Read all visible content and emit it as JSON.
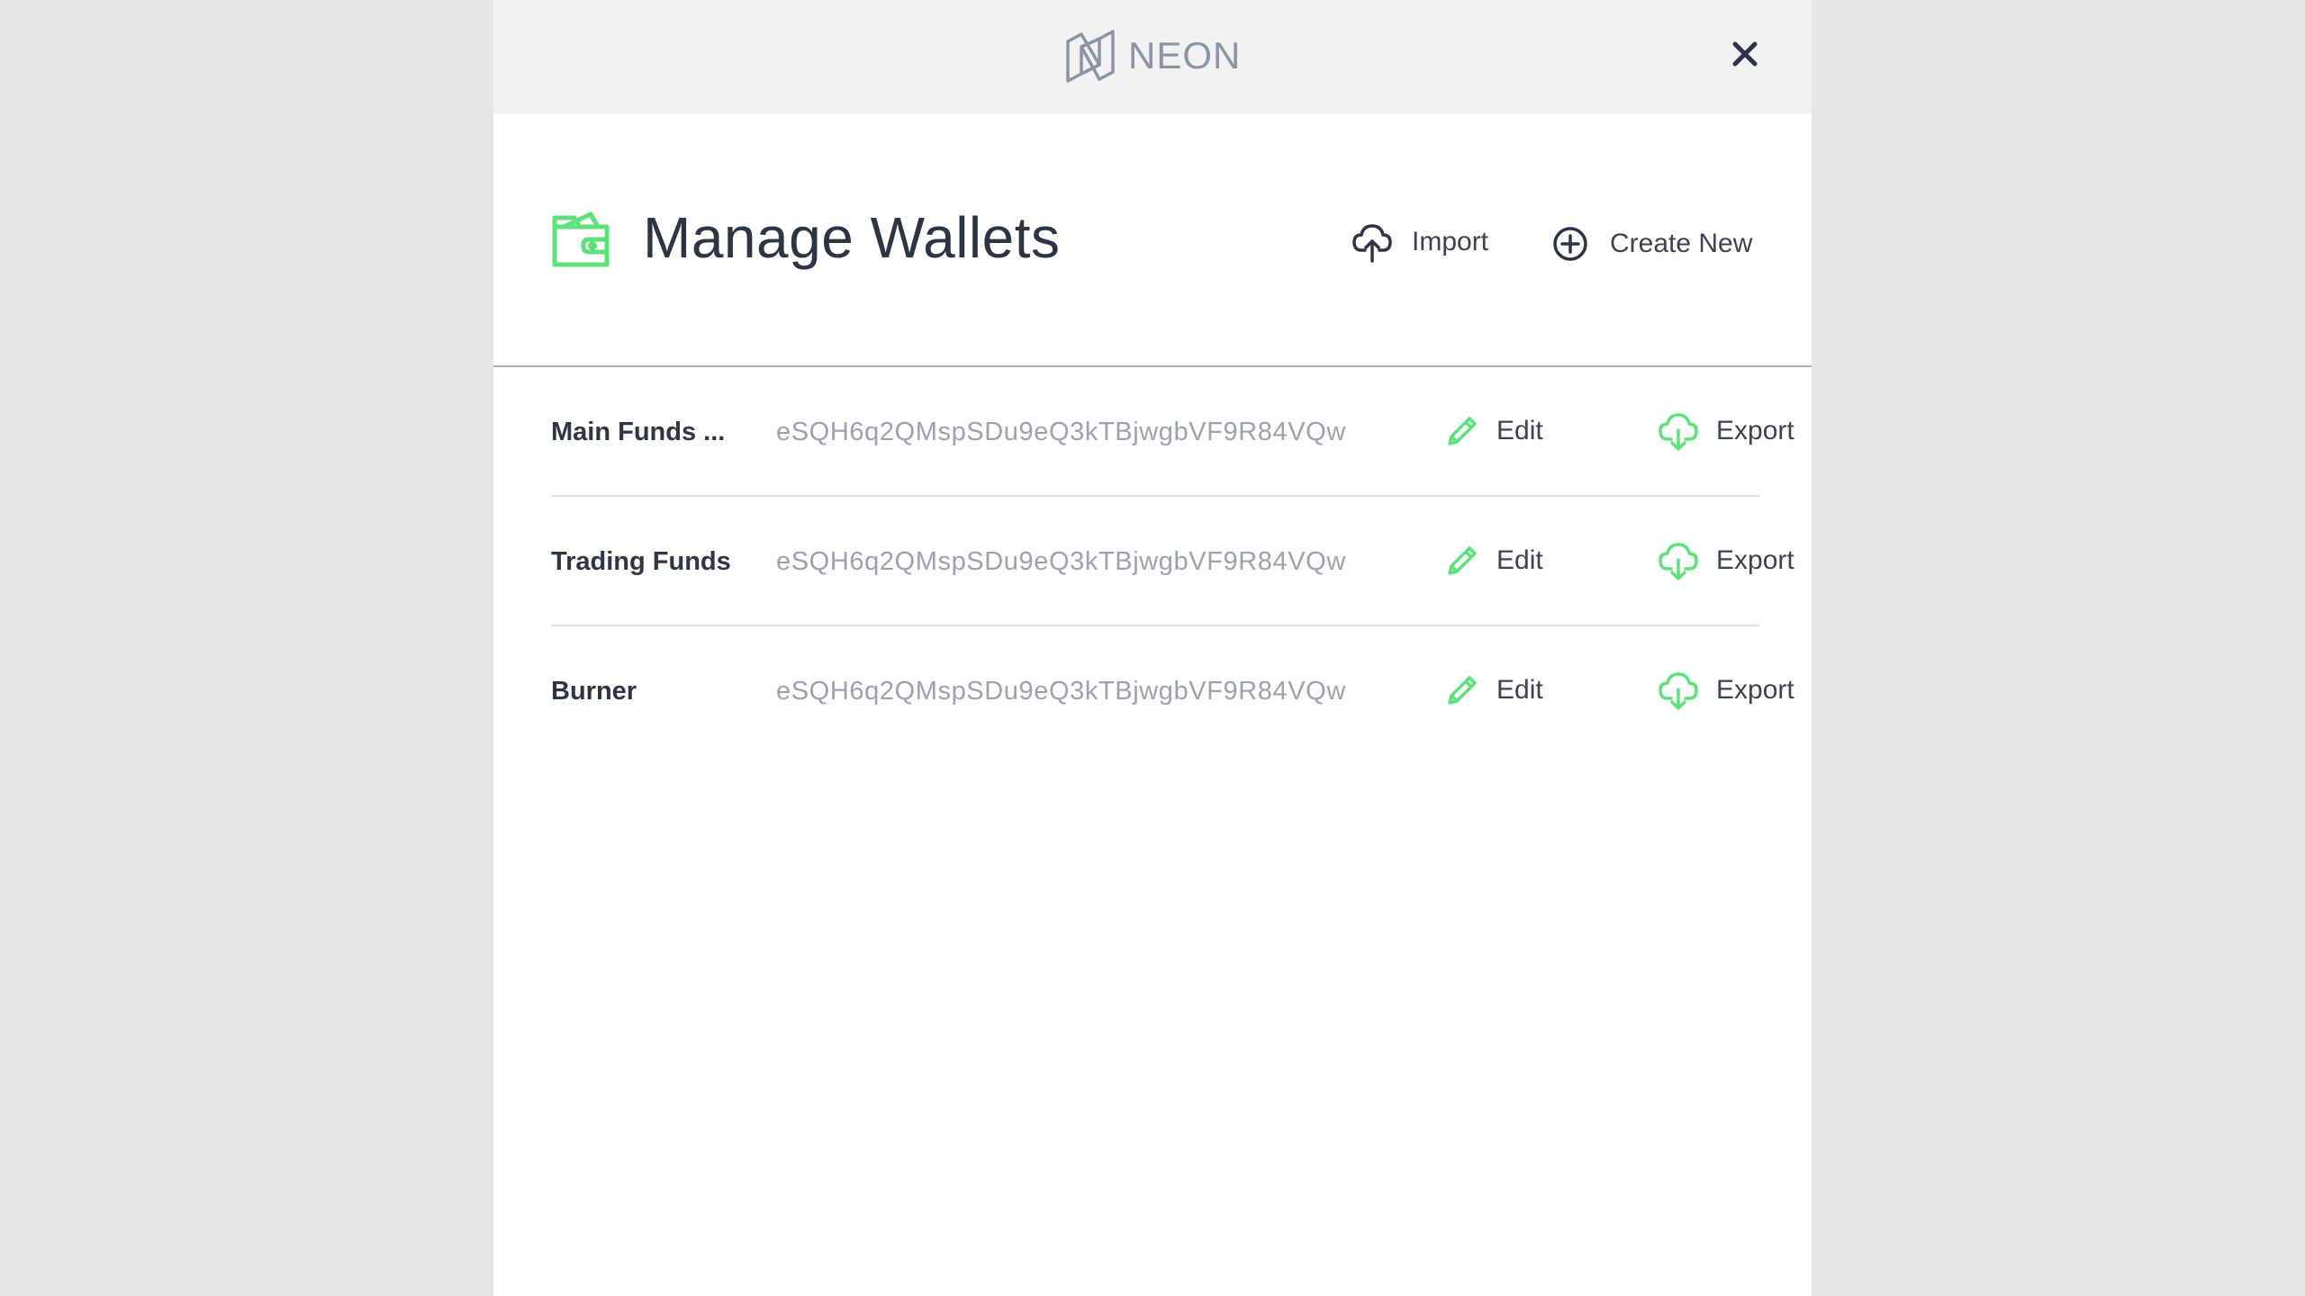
{
  "header": {
    "brand_name": "NEON"
  },
  "page": {
    "title": "Manage Wallets"
  },
  "actions": {
    "import_label": "Import",
    "create_label": "Create New"
  },
  "wallets": [
    {
      "name": "Main Funds ...",
      "address": "eSQH6q2QMspSDu9eQ3kTBjwgbVF9R84VQw",
      "edit_label": "Edit",
      "export_label": "Export"
    },
    {
      "name": "Trading Funds",
      "address": "eSQH6q2QMspSDu9eQ3kTBjwgbVF9R84VQw",
      "edit_label": "Edit",
      "export_label": "Export"
    },
    {
      "name": "Burner",
      "address": "eSQH6q2QMspSDu9eQ3kTBjwgbVF9R84VQw",
      "edit_label": "Edit",
      "export_label": "Export"
    }
  ],
  "colors": {
    "accent": "#5ee07a",
    "text_dark": "#2c3445",
    "text_muted": "#9aa1b1",
    "header_bg": "#f2f2f2",
    "backdrop": "#e6e6e6"
  },
  "icons": {
    "brand": "neon-logo-icon",
    "close": "close-icon",
    "title": "wallet-icon",
    "import": "cloud-upload-icon",
    "create": "plus-circle-icon",
    "edit": "pencil-icon",
    "export": "cloud-download-icon"
  }
}
